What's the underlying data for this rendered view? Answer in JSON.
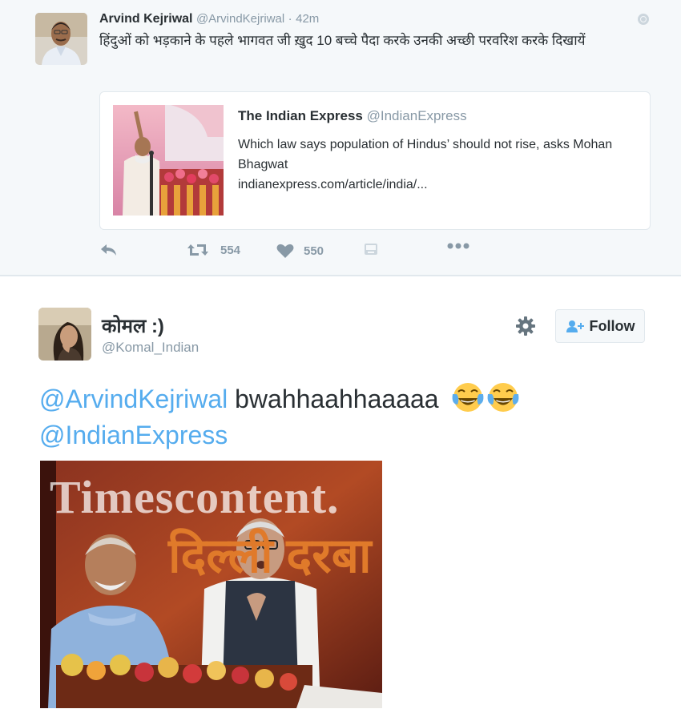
{
  "quoted_tweet": {
    "author_name": "Arvind Kejriwal",
    "author_handle": "@ArvindKejriwal",
    "separator": "·",
    "time": "42m",
    "text": "हिंदुओं को भड़काने के पहले भागवत जी ख़ुद 10 बच्चे पैदा करके उनकी अच्छी परवरिश करके दिखायें",
    "card": {
      "source_name": "The Indian Express",
      "source_handle": "@IndianExpress",
      "headline": "Which law says population of Hindus’ should not rise, asks Mohan Bhagwat",
      "link": "indianexpress.com/article/india/..."
    },
    "retweet_count": "554",
    "like_count": "550"
  },
  "main_tweet": {
    "author_name": "कोमल :)",
    "author_handle": "@Komal_Indian",
    "follow_label": "Follow",
    "mention1": "@ArvindKejriwal",
    "text": " bwahhaahhaaaaa",
    "mention2": "@IndianExpress",
    "photo": {
      "watermark": "Timescontent.",
      "banner_text": "दिल्ली दरबा"
    }
  },
  "colors": {
    "link_blue": "#55acee",
    "secondary_gray": "#8899a6",
    "quoted_background": "#f5f8fa"
  },
  "icons": [
    "globe-icon",
    "reply-icon",
    "retweet-icon",
    "heart-icon",
    "photo-icon",
    "more-icon",
    "gear-icon",
    "add-user-icon",
    "tears-of-joy-emoji"
  ]
}
